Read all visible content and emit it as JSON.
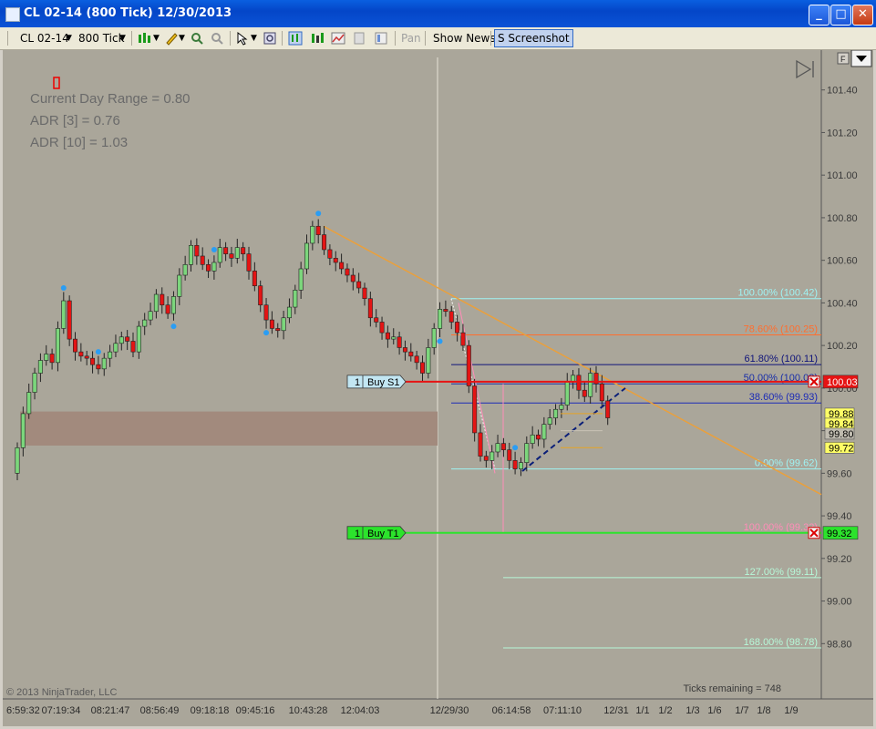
{
  "window": {
    "title": "CL 02-14 (800 Tick)  12/30/2013",
    "min_label": "_",
    "max_label": "□",
    "close_label": "✕"
  },
  "toolbar": {
    "instrument": "CL 02-14",
    "interval": "800 Tick",
    "pan_label": "Pan",
    "show_news_label": "Show News",
    "screenshot_label": "S Screenshot"
  },
  "chart_data": {
    "type": "candlestick",
    "instrument": "CL 02-14",
    "interval": "800 Tick",
    "ylim": [
      98.72,
      101.48
    ],
    "y_ticks": [
      {
        "value": 101.4,
        "label": "101.40"
      },
      {
        "value": 101.2,
        "label": "101.20"
      },
      {
        "value": 101.0,
        "label": "101.00"
      },
      {
        "value": 100.8,
        "label": "100.80"
      },
      {
        "value": 100.6,
        "label": "100.60"
      },
      {
        "value": 100.4,
        "label": "100.40"
      },
      {
        "value": 100.2,
        "label": "100.20"
      },
      {
        "value": 100.0,
        "label": "100.00"
      },
      {
        "value": 99.8,
        "label": "99.80"
      },
      {
        "value": 99.6,
        "label": "99.60"
      },
      {
        "value": 99.4,
        "label": "99.40"
      },
      {
        "value": 99.2,
        "label": "99.20"
      },
      {
        "value": 99.0,
        "label": "99.00"
      },
      {
        "value": 98.8,
        "label": "98.80"
      }
    ],
    "x_labels": [
      "6:59:32",
      "07:19:34",
      "08:21:47",
      "08:56:49",
      "09:18:18",
      "09:45:16",
      "10:43:28",
      "12:04:03",
      "12/29/30",
      "06:14:58",
      "07:11:10",
      "12/31",
      "1/1",
      "1/2",
      "1/3",
      "1/6",
      "1/7",
      "1/8",
      "1/9"
    ],
    "closes": [
      99.72,
      99.88,
      99.98,
      100.07,
      100.13,
      100.16,
      100.12,
      100.28,
      100.41,
      100.23,
      100.17,
      100.15,
      100.14,
      100.11,
      100.09,
      100.14,
      100.17,
      100.21,
      100.24,
      100.22,
      100.17,
      100.29,
      100.32,
      100.36,
      100.44,
      100.39,
      100.35,
      100.43,
      100.53,
      100.58,
      100.67,
      100.62,
      100.58,
      100.55,
      100.59,
      100.66,
      100.63,
      100.61,
      100.66,
      100.63,
      100.55,
      100.48,
      100.39,
      100.32,
      100.28,
      100.27,
      100.33,
      100.38,
      100.46,
      100.56,
      100.68,
      100.76,
      100.72,
      100.65,
      100.61,
      100.59,
      100.56,
      100.53,
      100.5,
      100.47,
      100.42,
      100.33,
      100.31,
      100.26,
      100.23,
      100.24,
      100.19,
      100.17,
      100.15,
      100.12,
      100.07,
      100.19,
      100.28,
      100.37,
      100.36,
      100.31,
      100.26,
      100.2,
      100.01,
      99.79,
      99.68,
      99.66,
      99.7,
      99.74,
      99.71,
      99.66,
      99.62,
      99.65,
      99.74,
      99.78,
      99.76,
      99.83,
      99.86,
      99.9,
      99.92,
      100.03,
      100.06,
      99.99,
      99.96,
      100.07,
      100.02,
      99.94,
      99.86
    ],
    "indicators": {
      "current_day_range_label": "Current Day Range = 0.80",
      "adr3_label": "ADR [3] = 0.76",
      "adr10_label": "ADR [10] = 1.03"
    },
    "fibonacci": [
      {
        "label": "100.00% (100.42)",
        "value": 100.42,
        "color": "#9ff3f3"
      },
      {
        "label": "78.60% (100.25)",
        "value": 100.25,
        "color": "#ff6e2e"
      },
      {
        "label": "61.80% (100.11)",
        "value": 100.11,
        "color": "#10147a"
      },
      {
        "label": "50.00% (100.02)",
        "value": 100.02,
        "color": "#1a2fa8"
      },
      {
        "label": "38.60% (99.93)",
        "value": 99.93,
        "color": "#1c2bb6"
      },
      {
        "label": "0.00% (99.62)",
        "value": 99.62,
        "color": "#9ff3f3"
      },
      {
        "label": "100.00% (99.32)",
        "value": 99.32,
        "color": "#ff8db8"
      },
      {
        "label": "127.00% (99.11)",
        "value": 99.11,
        "color": "#b6f8d8"
      },
      {
        "label": "168.00% (98.78)",
        "value": 98.78,
        "color": "#b6f8d8"
      }
    ],
    "orders": [
      {
        "qty": "1",
        "label": "Buy S1",
        "value": 100.03,
        "line_color": "#e61313",
        "price_label": "100.03"
      },
      {
        "qty": "1",
        "label": "Buy T1",
        "value": 99.32,
        "line_color": "#2ce32c",
        "price_label": "99.32"
      }
    ],
    "price_markers": [
      {
        "label": "99.88",
        "value": 99.88,
        "bg": "#ffff66"
      },
      {
        "label": "99.84",
        "value": 99.84,
        "bg": "#ffff66"
      },
      {
        "label": "99.80",
        "value": 99.8,
        "bg": "#c0bcb0"
      },
      {
        "label": "99.72",
        "value": 99.72,
        "bg": "#ffff66"
      }
    ],
    "zone_range": [
      99.73,
      99.89
    ],
    "trendline": {
      "from": 100.76,
      "to": 99.5,
      "color": "#eaa03c"
    },
    "copyright": "© 2013 NinjaTrader, LLC",
    "ticks_remaining": "Ticks remaining = 748",
    "f_label": "F"
  }
}
